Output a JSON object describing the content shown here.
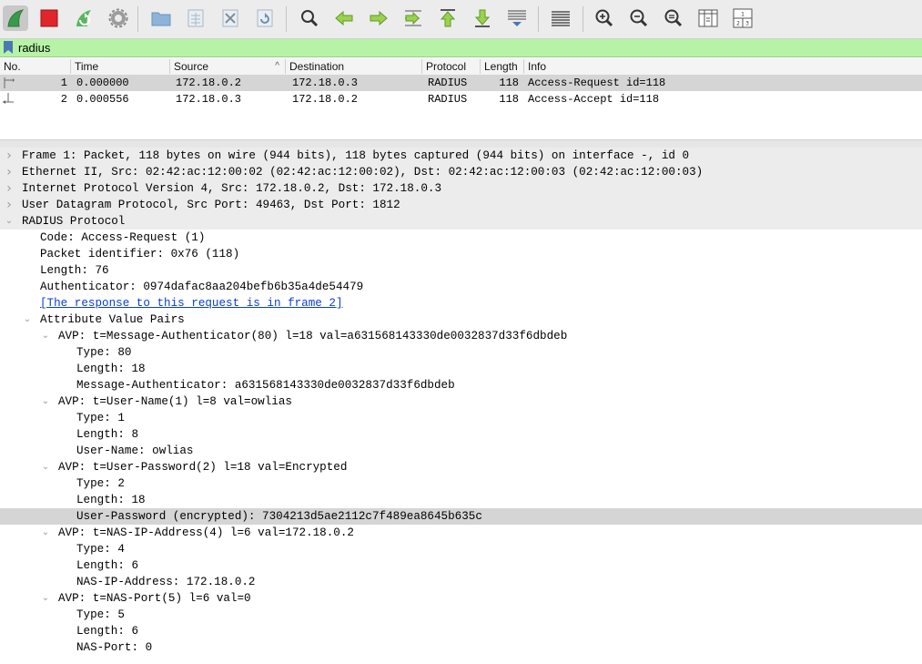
{
  "toolbar": {
    "icons": [
      "shark-fin-start-icon",
      "stop-capture-icon",
      "restart-capture-icon",
      "capture-options-gear-icon",
      "open-folder-icon",
      "save-file-icon",
      "close-file-icon",
      "reload-file-icon",
      "find-packet-icon",
      "go-back-icon",
      "go-forward-icon",
      "go-to-packet-icon",
      "first-packet-icon",
      "last-packet-icon",
      "autoscroll-icon",
      "colorize-icon",
      "zoom-in-icon",
      "zoom-out-icon",
      "normal-size-icon",
      "resize-columns-icon",
      "layout-icon"
    ]
  },
  "filter": {
    "value": "radius"
  },
  "packet_list": {
    "columns": [
      "No.",
      "Time",
      "Source",
      "Destination",
      "Protocol",
      "Length",
      "Info"
    ],
    "sort_indicator": "^",
    "rows": [
      {
        "no": "1",
        "time": "0.000000",
        "source": "172.18.0.2",
        "destination": "172.18.0.3",
        "protocol": "RADIUS",
        "length": "118",
        "info": "Access-Request id=118"
      },
      {
        "no": "2",
        "time": "0.000556",
        "source": "172.18.0.3",
        "destination": "172.18.0.2",
        "protocol": "RADIUS",
        "length": "118",
        "info": "Access-Accept id=118"
      }
    ]
  },
  "details": [
    {
      "text": "Frame 1: Packet, 118 bytes on wire (944 bits), 118 bytes captured (944 bits) on interface -, id 0",
      "state": "collapsed",
      "level": 0
    },
    {
      "text": "Ethernet II, Src: 02:42:ac:12:00:02 (02:42:ac:12:00:02), Dst: 02:42:ac:12:00:03 (02:42:ac:12:00:03)",
      "state": "collapsed",
      "level": 0
    },
    {
      "text": "Internet Protocol Version 4, Src: 172.18.0.2, Dst: 172.18.0.3",
      "state": "collapsed",
      "level": 0
    },
    {
      "text": "User Datagram Protocol, Src Port: 49463, Dst Port: 1812",
      "state": "collapsed",
      "level": 0
    },
    {
      "text": "RADIUS Protocol",
      "state": "expanded",
      "level": 0
    },
    {
      "text": "Code: Access-Request (1)",
      "state": "leaf",
      "level": 1
    },
    {
      "text": "Packet identifier: 0x76 (118)",
      "state": "leaf",
      "level": 1
    },
    {
      "text": "Length: 76",
      "state": "leaf",
      "level": 1
    },
    {
      "text": "Authenticator: 0974dafac8aa204befb6b35a4de54479",
      "state": "leaf",
      "level": 1
    },
    {
      "text": "[The response to this request is in frame 2]",
      "state": "link",
      "level": 1
    },
    {
      "text": "Attribute Value Pairs",
      "state": "expanded",
      "level": 1
    },
    {
      "text": "AVP: t=Message-Authenticator(80) l=18 val=a631568143330de0032837d33f6dbdeb",
      "state": "expanded",
      "level": 2
    },
    {
      "text": "Type: 80",
      "state": "leaf",
      "level": 3
    },
    {
      "text": "Length: 18",
      "state": "leaf",
      "level": 3
    },
    {
      "text": "Message-Authenticator: a631568143330de0032837d33f6dbdeb",
      "state": "leaf",
      "level": 3
    },
    {
      "text": "AVP: t=User-Name(1) l=8 val=owlias",
      "state": "expanded",
      "level": 2
    },
    {
      "text": "Type: 1",
      "state": "leaf",
      "level": 3
    },
    {
      "text": "Length: 8",
      "state": "leaf",
      "level": 3
    },
    {
      "text": "User-Name: owlias",
      "state": "leaf",
      "level": 3
    },
    {
      "text": "AVP: t=User-Password(2) l=18 val=Encrypted",
      "state": "expanded",
      "level": 2
    },
    {
      "text": "Type: 2",
      "state": "leaf",
      "level": 3
    },
    {
      "text": "Length: 18",
      "state": "leaf",
      "level": 3
    },
    {
      "text": "User-Password (encrypted): 7304213d5ae2112c7f489ea8645b635c",
      "state": "leaf",
      "level": 3,
      "selected": true
    },
    {
      "text": "AVP: t=NAS-IP-Address(4) l=6 val=172.18.0.2",
      "state": "expanded",
      "level": 2
    },
    {
      "text": "Type: 4",
      "state": "leaf",
      "level": 3
    },
    {
      "text": "Length: 6",
      "state": "leaf",
      "level": 3
    },
    {
      "text": "NAS-IP-Address: 172.18.0.2",
      "state": "leaf",
      "level": 3
    },
    {
      "text": "AVP: t=NAS-Port(5) l=6 val=0",
      "state": "expanded",
      "level": 2
    },
    {
      "text": "Type: 5",
      "state": "leaf",
      "level": 3
    },
    {
      "text": "Length: 6",
      "state": "leaf",
      "level": 3
    },
    {
      "text": "NAS-Port: 0",
      "state": "leaf",
      "level": 3
    }
  ],
  "colors": {
    "filter_bg": "#b6f3a6",
    "selected_row": "#d5d5d5",
    "link": "#0a3fd1",
    "toolbar_bg": "#ececec"
  }
}
